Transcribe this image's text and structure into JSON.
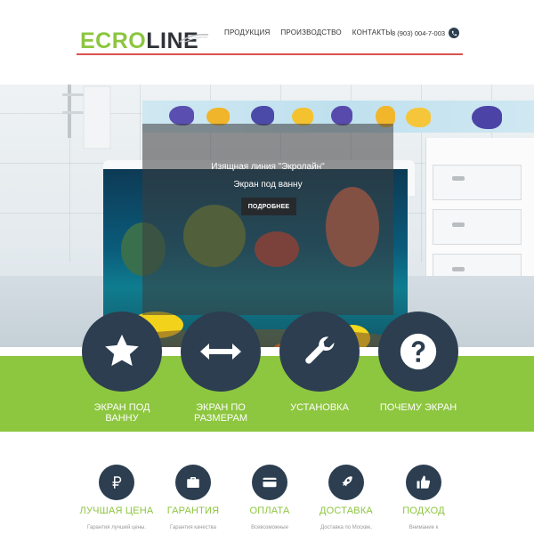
{
  "brand": {
    "logo_part1": "ECRO",
    "logo_part2": "LINE"
  },
  "nav": {
    "items": [
      "ПРОДУКЦИЯ",
      "ПРОИЗВОДСТВО",
      "КОНТАКТЫ"
    ]
  },
  "phone": {
    "number": "8 (903) 004-7-003",
    "icon": "phone-icon"
  },
  "hero": {
    "title": "Изящная линия \"Экролайн\"",
    "subtitle": "Экран под ванну",
    "button": "ПОДРОБНЕЕ"
  },
  "services": [
    {
      "icon": "star-icon",
      "label_line1": "ЭКРАН ПОД",
      "label_line2": "ВАННУ"
    },
    {
      "icon": "arrows-horizontal-icon",
      "label_line1": "ЭКРАН ПО",
      "label_line2": "РАЗМЕРАМ"
    },
    {
      "icon": "wrench-icon",
      "label_line1": "УСТАНОВКА",
      "label_line2": ""
    },
    {
      "icon": "question-icon",
      "label_line1": "ПОЧЕМУ ЭКРАН",
      "label_line2": ""
    }
  ],
  "features": [
    {
      "icon": "ruble-icon",
      "title": "ЛУЧШАЯ ЦЕНА",
      "desc": "Гарантия лучшей цены."
    },
    {
      "icon": "briefcase-icon",
      "title": "ГАРАНТИЯ",
      "desc": "Гарантия качества"
    },
    {
      "icon": "credit-card-icon",
      "title": "ОПЛАТА",
      "desc": "Всевозможные"
    },
    {
      "icon": "rocket-icon",
      "title": "ДОСТАВКА",
      "desc": "Доставка по Москве,"
    },
    {
      "icon": "thumbs-up-icon",
      "title": "ПОДХОД",
      "desc": "Внимание к"
    }
  ],
  "colors": {
    "accent_green": "#8dc63f",
    "dark_navy": "#2c3e50",
    "header_line": "#d9534f"
  }
}
